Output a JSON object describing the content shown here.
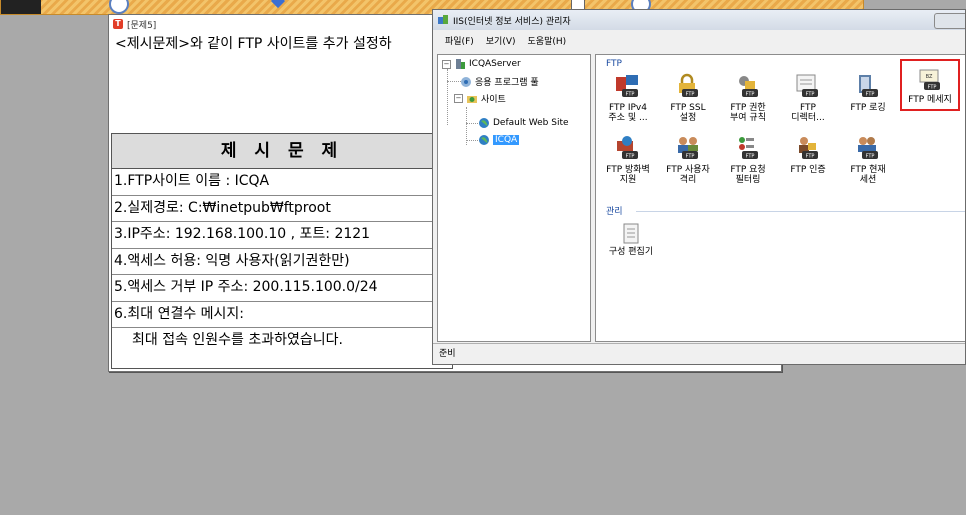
{
  "problem_window": {
    "title": "[문제5]",
    "instruction": "<제시문제>와 같이 FTP 사이트를 추가 설정하",
    "example": {
      "heading": "제 시 문 제",
      "lines": [
        "1.FTP사이트 이름 : ICQA",
        "2.실제경로: C:₩inetpub₩ftproot",
        "3.IP주소: 192.168.100.10 , 포트: 2121",
        "4.액세스 허용: 익명 사용자(읽기권한만)",
        "5.액세스 거부 IP 주소:  200.115.100.0/24",
        "6.최대 연결수 메시지:",
        "최대 접속 인원수를 초과하였습니다."
      ]
    }
  },
  "iis": {
    "title": "IIS(인터넷 정보 서비스) 관리자",
    "menu": [
      "파일(F)",
      "보기(V)",
      "도움말(H)"
    ],
    "tree": {
      "server": "ICQAServer",
      "app_pool": "응용 프로그램 풀",
      "sites": "사이트",
      "default_site": "Default Web Site",
      "selected_site": "ICQA"
    },
    "groups": {
      "ftp": "FTP",
      "manage": "관리"
    },
    "features_row1": [
      {
        "l1": "FTP IPv4",
        "l2": "주소 및 ...",
        "icon": "ftp-ipv4-icon"
      },
      {
        "l1": "FTP SSL",
        "l2": "설정",
        "icon": "ftp-ssl-icon"
      },
      {
        "l1": "FTP 권한",
        "l2": "부여 규칙",
        "icon": "ftp-authorization-icon"
      },
      {
        "l1": "FTP",
        "l2": "디렉터...",
        "icon": "ftp-directory-icon"
      },
      {
        "l1": "FTP 로깅",
        "l2": "",
        "icon": "ftp-logging-icon"
      },
      {
        "l1": "FTP 메세지",
        "l2": "",
        "icon": "ftp-messages-icon"
      }
    ],
    "features_row2": [
      {
        "l1": "FTP 방화벽",
        "l2": "지원",
        "icon": "ftp-firewall-icon"
      },
      {
        "l1": "FTP 사용자",
        "l2": "격리",
        "icon": "ftp-user-isolation-icon"
      },
      {
        "l1": "FTP 요청",
        "l2": "필터링",
        "icon": "ftp-request-filtering-icon"
      },
      {
        "l1": "FTP 인증",
        "l2": "",
        "icon": "ftp-authentication-icon"
      },
      {
        "l1": "FTP 현재",
        "l2": "세션",
        "icon": "ftp-sessions-icon"
      }
    ],
    "manage_features": [
      {
        "l1": "구성 편집기",
        "icon": "config-editor-icon"
      }
    ],
    "status": "준비"
  },
  "colors": {
    "desktop": "#a9a9a9",
    "highlight_border": "#e02020",
    "selection": "#3399ff"
  }
}
